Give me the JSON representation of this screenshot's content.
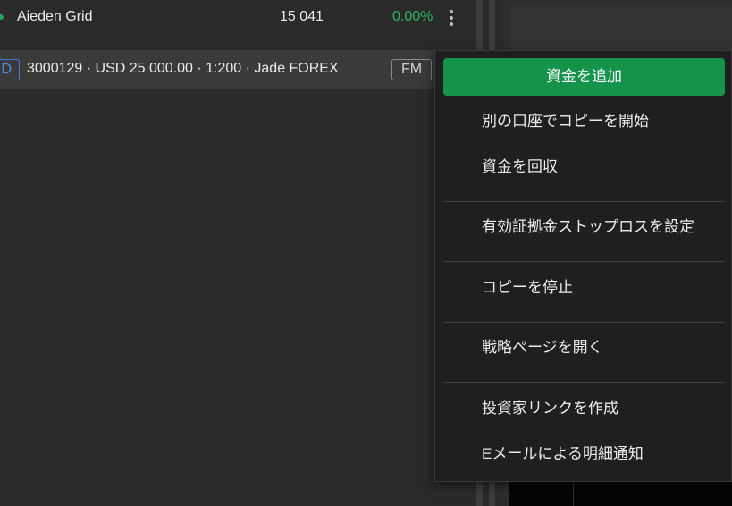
{
  "strategy": {
    "name": "Aieden Grid",
    "count": "15 041",
    "percent": "0.00%"
  },
  "account": {
    "type_badge": "D",
    "summary": "3000129 · USD 25 000.00 · 1:200 · Jade FOREX",
    "mode_badge": "FM"
  },
  "menu": {
    "primary": "資金を追加",
    "items": [
      "別の口座でコピーを開始",
      "資金を回収",
      "有効証拠金ストップロスを設定",
      "コピーを停止",
      "戦略ページを開く",
      "投資家リンクを作成",
      "Eメールによる明細通知"
    ]
  },
  "colors": {
    "accent_green": "#14934a",
    "positive_text": "#2fb35e",
    "badge_blue": "#3b82d8"
  }
}
